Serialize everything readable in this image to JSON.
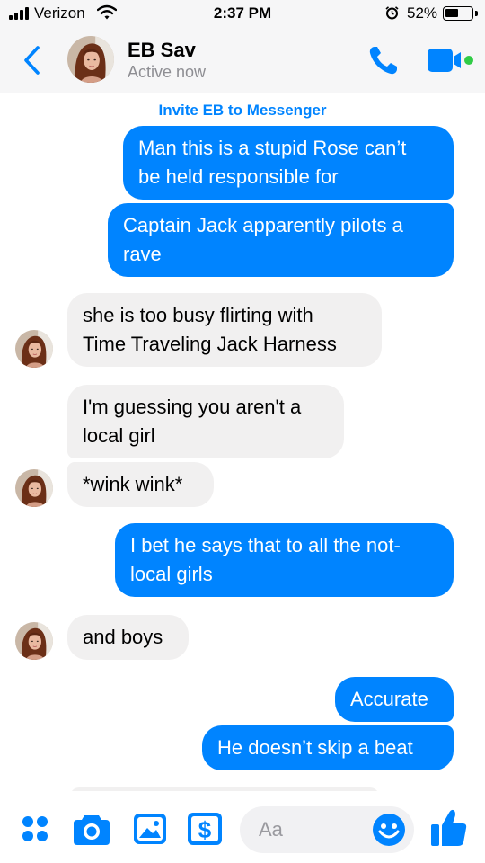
{
  "status_bar": {
    "carrier": "Verizon",
    "time": "2:37 PM",
    "battery_percent": "52%",
    "battery_level": 0.52,
    "icons": [
      "signal-icon",
      "wifi-icon",
      "alarm-icon",
      "battery-icon"
    ]
  },
  "header": {
    "contact_name": "EB Sav",
    "contact_status": "Active now",
    "icons": [
      "back-chevron-icon",
      "avatar",
      "phone-call-icon",
      "video-call-icon"
    ]
  },
  "chat": {
    "invite_text": "Invite EB to Messenger",
    "messages": [
      {
        "from": "me",
        "lines": [
          "Man this is a stupid Rose can’t",
          "be held responsible for"
        ]
      },
      {
        "from": "me",
        "lines": [
          "Captain Jack apparently pilots a",
          "rave"
        ]
      },
      {
        "from": "them",
        "lines": [
          "she is too busy flirting with",
          "Time Traveling Jack Harness"
        ]
      },
      {
        "from": "them",
        "lines": [
          "I'm guessing you aren't a",
          "local girl"
        ]
      },
      {
        "from": "them",
        "lines": [
          "*wink wink*"
        ]
      },
      {
        "from": "me",
        "lines": [
          "I bet he says that to all the not-",
          "local girls"
        ]
      },
      {
        "from": "them",
        "lines": [
          "and boys"
        ]
      },
      {
        "from": "me",
        "lines": [
          "Accurate"
        ]
      },
      {
        "from": "me",
        "lines": [
          "He doesn’t skip a beat"
        ]
      }
    ]
  },
  "composer": {
    "placeholder": "Aa",
    "icons": [
      "more-apps-icon",
      "camera-icon",
      "image-icon",
      "payment-icon",
      "emoji-icon",
      "like-thumbs-up-icon"
    ]
  },
  "colors": {
    "accent": "#0084ff",
    "sent_bubble": "#0084ff",
    "received_bubble": "#f1f0f0",
    "online_dot": "#31cc46",
    "muted_text": "#8e8e93"
  }
}
